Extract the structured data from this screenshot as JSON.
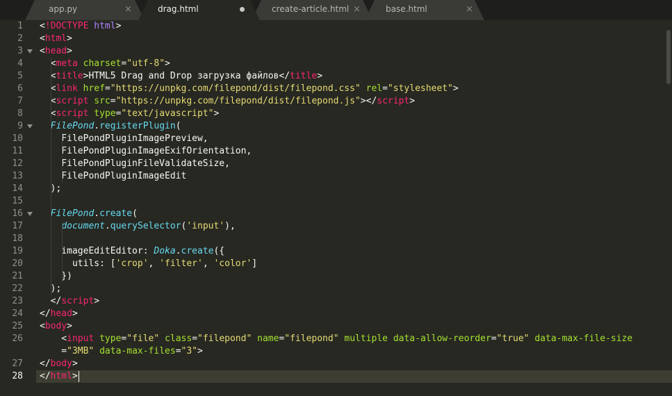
{
  "tabs": [
    {
      "label": "app.py",
      "state": "close",
      "active": false
    },
    {
      "label": "drag.html",
      "state": "modified",
      "active": true
    },
    {
      "label": "create-article.html",
      "state": "close",
      "active": false
    },
    {
      "label": "base.html",
      "state": "close",
      "active": false
    }
  ],
  "close_glyph": "×",
  "editor": {
    "current_line": 28,
    "line_numbers": [
      "1",
      "2",
      "3",
      "4",
      "5",
      "6",
      "7",
      "8",
      "9",
      "10",
      "11",
      "12",
      "13",
      "14",
      "15",
      "16",
      "17",
      "18",
      "19",
      "20",
      "21",
      "22",
      "23",
      "24",
      "25",
      "26",
      "",
      "27",
      "28"
    ],
    "lines": [
      [
        [
          "t-pl",
          "<"
        ],
        [
          "t-tag",
          "!DOCTYPE"
        ],
        [
          "t-pl",
          " "
        ],
        [
          "t-dt",
          "html"
        ],
        [
          "t-pl",
          ">"
        ]
      ],
      [
        [
          "t-pl",
          "<"
        ],
        [
          "t-tag",
          "html"
        ],
        [
          "t-pl",
          ">"
        ]
      ],
      [
        [
          "t-pl",
          "<"
        ],
        [
          "t-tag",
          "head"
        ],
        [
          "t-pl",
          ">"
        ]
      ],
      [
        [
          "t-pl",
          "  <"
        ],
        [
          "t-tag",
          "meta"
        ],
        [
          "t-pl",
          " "
        ],
        [
          "t-attr",
          "charset"
        ],
        [
          "t-pl",
          "="
        ],
        [
          "t-str",
          "\"utf-8\""
        ],
        [
          "t-pl",
          ">"
        ]
      ],
      [
        [
          "t-pl",
          "  <"
        ],
        [
          "t-tag",
          "title"
        ],
        [
          "t-pl",
          ">HTML5 Drag and Drop загрузка файлов</"
        ],
        [
          "t-tag",
          "title"
        ],
        [
          "t-pl",
          ">"
        ]
      ],
      [
        [
          "t-pl",
          "  <"
        ],
        [
          "t-tag",
          "link"
        ],
        [
          "t-pl",
          " "
        ],
        [
          "t-attr",
          "href"
        ],
        [
          "t-pl",
          "="
        ],
        [
          "t-str",
          "\"https://unpkg.com/filepond/dist/filepond.css\""
        ],
        [
          "t-pl",
          " "
        ],
        [
          "t-attr",
          "rel"
        ],
        [
          "t-pl",
          "="
        ],
        [
          "t-str",
          "\"stylesheet\""
        ],
        [
          "t-pl",
          ">"
        ]
      ],
      [
        [
          "t-pl",
          "  <"
        ],
        [
          "t-tag",
          "script"
        ],
        [
          "t-pl",
          " "
        ],
        [
          "t-attr",
          "src"
        ],
        [
          "t-pl",
          "="
        ],
        [
          "t-str",
          "\"https://unpkg.com/filepond/dist/filepond.js\""
        ],
        [
          "t-pl",
          "></"
        ],
        [
          "t-tag",
          "script"
        ],
        [
          "t-pl",
          ">"
        ]
      ],
      [
        [
          "t-pl",
          "  <"
        ],
        [
          "t-tag",
          "script"
        ],
        [
          "t-pl",
          " "
        ],
        [
          "t-attr",
          "type"
        ],
        [
          "t-pl",
          "="
        ],
        [
          "t-str",
          "\"text/javascript\""
        ],
        [
          "t-pl",
          ">"
        ]
      ],
      [
        [
          "t-pl",
          "  "
        ],
        [
          "t-it",
          "FilePond"
        ],
        [
          "t-pl",
          "."
        ],
        [
          "t-fn",
          "registerPlugin"
        ],
        [
          "t-pl",
          "("
        ]
      ],
      [
        [
          "t-pl",
          "    FilePondPluginImagePreview,"
        ]
      ],
      [
        [
          "t-pl",
          "    FilePondPluginImageExifOrientation,"
        ]
      ],
      [
        [
          "t-pl",
          "    FilePondPluginFileValidateSize,"
        ]
      ],
      [
        [
          "t-pl",
          "    FilePondPluginImageEdit"
        ]
      ],
      [
        [
          "t-pl",
          "  );"
        ]
      ],
      [],
      [
        [
          "t-pl",
          "  "
        ],
        [
          "t-it",
          "FilePond"
        ],
        [
          "t-pl",
          "."
        ],
        [
          "t-fn",
          "create"
        ],
        [
          "t-pl",
          "("
        ]
      ],
      [
        [
          "t-pl",
          "    "
        ],
        [
          "t-it",
          "document"
        ],
        [
          "t-pl",
          "."
        ],
        [
          "t-fn",
          "querySelector"
        ],
        [
          "t-pl",
          "("
        ],
        [
          "t-str",
          "'input'"
        ],
        [
          "t-pl",
          "),"
        ]
      ],
      [],
      [
        [
          "t-pl",
          "    imageEditEditor: "
        ],
        [
          "t-it",
          "Doka"
        ],
        [
          "t-pl",
          "."
        ],
        [
          "t-fn",
          "create"
        ],
        [
          "t-pl",
          "({"
        ]
      ],
      [
        [
          "t-pl",
          "      utils: ["
        ],
        [
          "t-str",
          "'crop'"
        ],
        [
          "t-pl",
          ", "
        ],
        [
          "t-str",
          "'filter'"
        ],
        [
          "t-pl",
          ", "
        ],
        [
          "t-str",
          "'color'"
        ],
        [
          "t-pl",
          "]"
        ]
      ],
      [
        [
          "t-pl",
          "    })"
        ]
      ],
      [
        [
          "t-pl",
          "  );"
        ]
      ],
      [
        [
          "t-pl",
          "  </"
        ],
        [
          "t-tag",
          "script"
        ],
        [
          "t-pl",
          ">"
        ]
      ],
      [
        [
          "t-pl",
          "</"
        ],
        [
          "t-tag",
          "head"
        ],
        [
          "t-pl",
          ">"
        ]
      ],
      [
        [
          "t-pl",
          "<"
        ],
        [
          "t-tag",
          "body"
        ],
        [
          "t-pl",
          ">"
        ]
      ],
      [
        [
          "t-pl",
          "    <"
        ],
        [
          "t-tag",
          "input"
        ],
        [
          "t-pl",
          " "
        ],
        [
          "t-attr",
          "type"
        ],
        [
          "t-pl",
          "="
        ],
        [
          "t-str",
          "\"file\""
        ],
        [
          "t-pl",
          " "
        ],
        [
          "t-attr",
          "class"
        ],
        [
          "t-pl",
          "="
        ],
        [
          "t-str",
          "\"filepond\""
        ],
        [
          "t-pl",
          " "
        ],
        [
          "t-attr",
          "name"
        ],
        [
          "t-pl",
          "="
        ],
        [
          "t-str",
          "\"filepond\""
        ],
        [
          "t-pl",
          " "
        ],
        [
          "t-attr",
          "multiple"
        ],
        [
          "t-pl",
          " "
        ],
        [
          "t-attr",
          "data-allow-reorder"
        ],
        [
          "t-pl",
          "="
        ],
        [
          "t-str",
          "\"true\""
        ],
        [
          "t-pl",
          " "
        ],
        [
          "t-attr",
          "data-max-file-size"
        ]
      ],
      [
        [
          "t-pl",
          "    ="
        ],
        [
          "t-str",
          "\"3MB\""
        ],
        [
          "t-pl",
          " "
        ],
        [
          "t-attr",
          "data-max-files"
        ],
        [
          "t-pl",
          "="
        ],
        [
          "t-str",
          "\"3\""
        ],
        [
          "t-pl",
          ">"
        ]
      ],
      [
        [
          "t-pl",
          "</"
        ],
        [
          "t-tag",
          "body"
        ],
        [
          "t-pl",
          ">"
        ]
      ],
      [
        [
          "t-pl",
          "</"
        ],
        [
          "t-tag",
          "html"
        ],
        [
          "t-pl",
          ">"
        ]
      ]
    ]
  }
}
